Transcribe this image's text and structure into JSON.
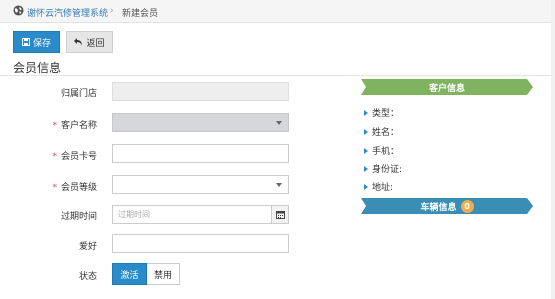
{
  "breadcrumb": {
    "home": "谢怀云汽修管理系统",
    "separator": "›",
    "current": "新建会员"
  },
  "toolbar": {
    "save_label": "保存",
    "save_icon": "save-icon",
    "back_label": "返回",
    "back_icon": "undo-arrow-icon"
  },
  "section_title": "会员信息",
  "form": {
    "store_label": "归属门店",
    "store_value": "",
    "customer_label": "客户名称",
    "customer_value": "",
    "card_label": "会员卡号",
    "card_value": "",
    "level_label": "会员等级",
    "level_value": "",
    "expire_label": "过期时间",
    "expire_placeholder": "过期时间",
    "hobby_label": "爱好",
    "hobby_value": "",
    "status_label": "状态",
    "status_on": "激活",
    "status_off": "禁用",
    "required_mark": "*"
  },
  "customer_panel": {
    "title": "客户信息",
    "color": "#7fb35f",
    "rows": [
      "类型：",
      "姓名：",
      "手机：",
      "身份证:",
      "地址:"
    ]
  },
  "vehicle_panel": {
    "title": "车辆信息",
    "count": "0",
    "color": "#3a8db4"
  },
  "colors": {
    "primary": "#2a8bcb",
    "required": "#d9534f",
    "badge": "#f0ad4e"
  }
}
